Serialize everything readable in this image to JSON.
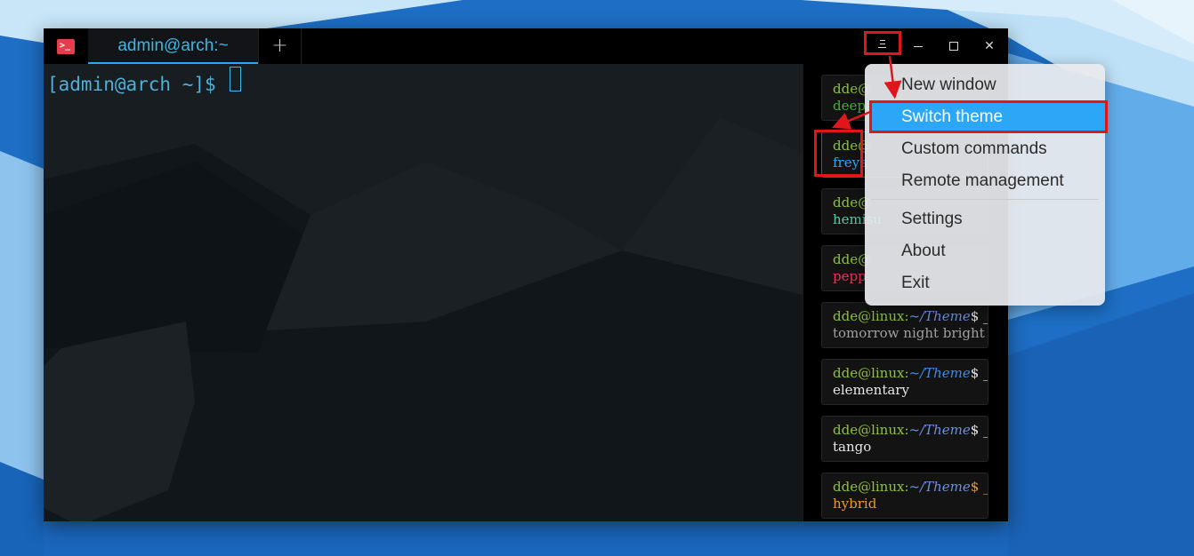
{
  "window": {
    "tab_title": "admin@arch:~",
    "new_tab_label": "+",
    "close_label": "✕"
  },
  "terminal": {
    "prompt": "[admin@arch ~]$"
  },
  "themes": [
    {
      "user": "dde@",
      "path": "",
      "suffix": "",
      "name": "deepin",
      "name_color": "#3fb52e"
    },
    {
      "user": "dde@",
      "path": "",
      "suffix": "",
      "name": "freya",
      "name_color": "#2ca7f8"
    },
    {
      "user": "dde@",
      "path": "",
      "suffix": "",
      "name": "hemisu",
      "name_color": "#4dd0a8"
    },
    {
      "user": "dde@",
      "path": "",
      "suffix": "",
      "name": "pepp",
      "name_color": "#e8355a"
    },
    {
      "user": "dde@linux:",
      "path": "~/Theme",
      "suffix": "$ _",
      "name": "tomorrow night bright",
      "name_color": "#a0a0a0"
    },
    {
      "user": "dde@linux:",
      "path": "~/Theme",
      "suffix": "$ _",
      "name": "elementary",
      "name_color": "#e6e6e6"
    },
    {
      "user": "dde@linux:",
      "path": "~/Theme",
      "suffix": "$ _",
      "name": "tango",
      "name_color": "#e6e6e6"
    },
    {
      "user": "dde@linux:",
      "path": "~/Theme",
      "suffix": "$ _",
      "name": "hybrid",
      "name_color": "#e89a2c"
    }
  ],
  "menu": {
    "items": [
      "New window",
      "Switch theme",
      "Custom commands",
      "Remote management",
      "Settings",
      "About",
      "Exit"
    ],
    "active": "Switch theme"
  },
  "colors": {
    "accent": "#2ca7f8",
    "annotation": "#e0161b",
    "prompt": "#4eb0d6"
  }
}
